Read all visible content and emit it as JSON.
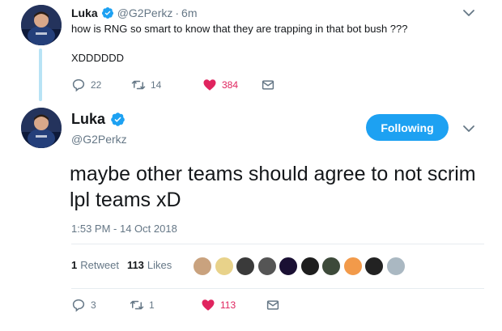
{
  "parent_tweet": {
    "name": "Luka",
    "handle": "@G2Perkz",
    "separator": "·",
    "time": "6m",
    "text_line1": "how is RNG so smart to know that they are trapping in that bot bush ???",
    "text_line2": "XDDDDDD",
    "replies": "22",
    "retweets": "14",
    "likes": "384"
  },
  "main_tweet": {
    "name": "Luka",
    "handle": "@G2Perkz",
    "follow_label": "Following",
    "text": "maybe other teams should agree to not scrim lpl teams xD",
    "timestamp": "1:53 PM - 14 Oct 2018",
    "retweet_count": "1",
    "retweet_label": "Retweet",
    "like_count": "113",
    "like_label": "Likes",
    "replies": "3",
    "retweets": "1",
    "likes": "113"
  },
  "likers": [
    {
      "name": "liker-avatar-1",
      "color": "#c9a27e"
    },
    {
      "name": "liker-avatar-2",
      "color": "#e8d28a"
    },
    {
      "name": "liker-avatar-3",
      "color": "#3a3a3a"
    },
    {
      "name": "liker-avatar-4",
      "color": "#555555"
    },
    {
      "name": "liker-avatar-5",
      "color": "#1a1033"
    },
    {
      "name": "liker-avatar-6",
      "color": "#1e1e1e"
    },
    {
      "name": "liker-avatar-7",
      "color": "#3d4a3a"
    },
    {
      "name": "liker-avatar-8",
      "color": "#f29a4a"
    },
    {
      "name": "liker-avatar-9",
      "color": "#222222"
    },
    {
      "name": "liker-avatar-10",
      "color": "#aab8c2"
    }
  ],
  "colors": {
    "accent": "#1da1f2",
    "like_red": "#e0245e",
    "muted": "#657786",
    "thread_line": "#b8e3f5"
  }
}
